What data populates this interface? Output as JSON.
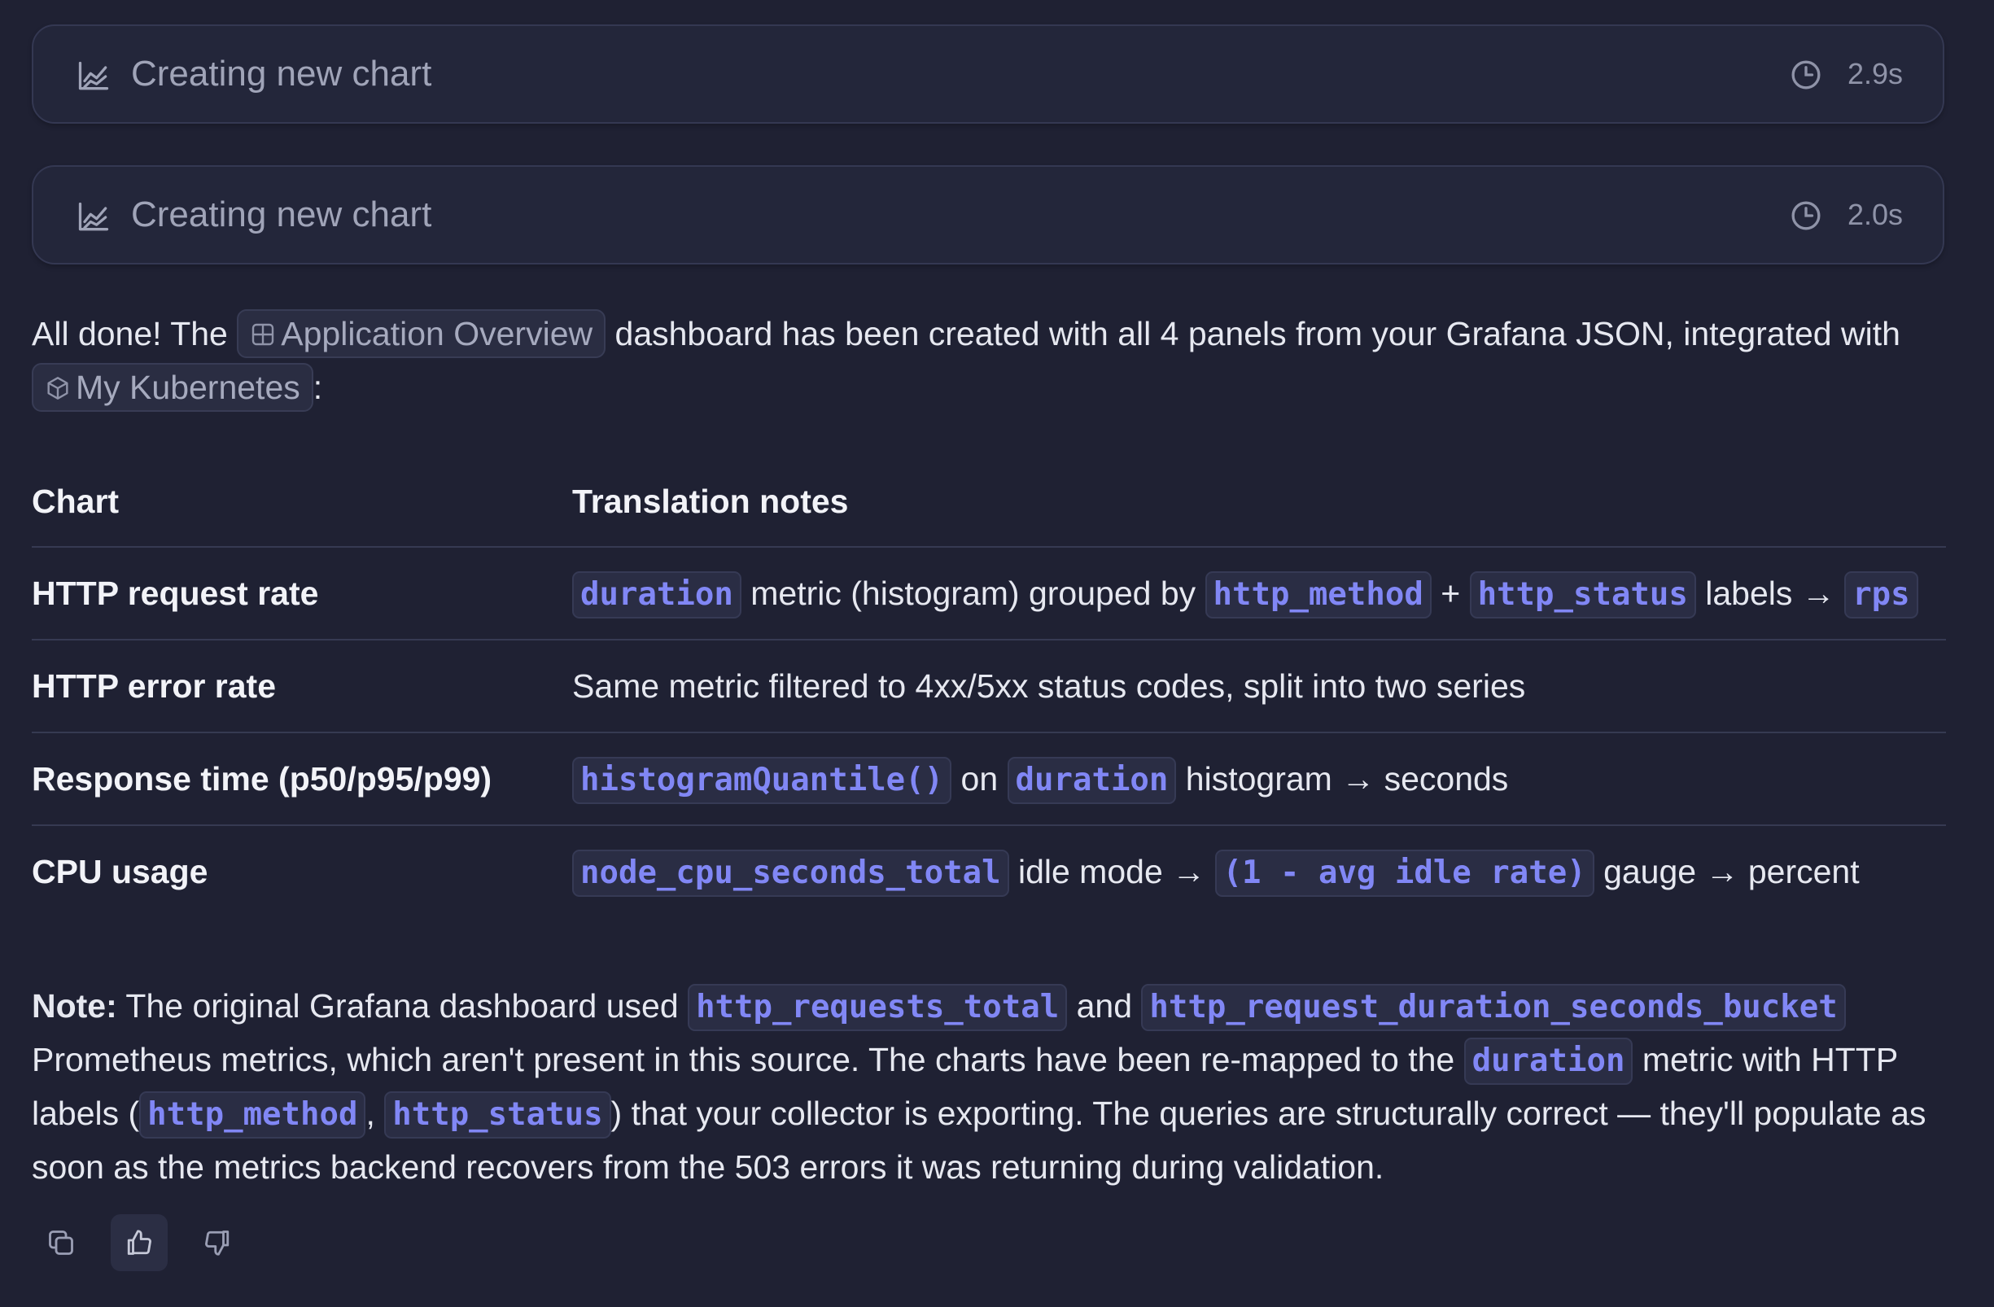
{
  "steps": [
    {
      "title": "Creating new chart",
      "time": "2.9s",
      "icon": "chart-icon"
    },
    {
      "title": "Creating new chart",
      "time": "2.0s",
      "icon": "chart-icon"
    }
  ],
  "summary": {
    "text1": "All done! The",
    "dashboard_chip": "Application Overview",
    "text2": "dashboard has been created with all 4 panels from your Grafana JSON, integrated with",
    "source_chip": "My Kubernetes",
    "text3": ":"
  },
  "table": {
    "headers": [
      "Chart",
      "Translation notes"
    ],
    "rows": [
      {
        "chart": "HTTP request rate",
        "notes": {
          "c1": "duration",
          "t1": "metric (histogram) grouped by",
          "c2": "http_method",
          "t2": "+",
          "c3": "http_status",
          "t3": "labels →",
          "c4": "rps"
        }
      },
      {
        "chart": "HTTP error rate",
        "notes": {
          "t1": "Same metric filtered to 4xx/5xx status codes, split into two series"
        }
      },
      {
        "chart": "Response time (p50/p95/p99)",
        "notes": {
          "c1": "histogramQuantile()",
          "t1": "on",
          "c2": "duration",
          "t2": "histogram → seconds"
        }
      },
      {
        "chart": "CPU usage",
        "notes": {
          "c1": "node_cpu_seconds_total",
          "t1": "idle mode →",
          "c2": "(1 - avg idle rate)",
          "t2": "gauge → percent"
        }
      }
    ]
  },
  "note": {
    "label": "Note:",
    "t1": "The original Grafana dashboard used",
    "c1": "http_requests_total",
    "t2": "and",
    "c2": "http_request_duration_seconds_bucket",
    "t3": "Prometheus metrics, which aren't present in this source. The charts have been re-mapped to the",
    "c3": "duration",
    "t4": "metric with HTTP labels (",
    "c4": "http_method",
    "t5": ",",
    "c5": "http_status",
    "t6": ") that your collector is exporting. The queries are structurally correct — they'll populate as soon as the metrics backend recovers from the 503 errors it was returning during validation."
  },
  "feedback": {
    "copy_icon": "copy-icon",
    "like_icon": "thumbs-up-icon",
    "dislike_icon": "thumbs-down-icon",
    "like_active": true
  },
  "colors": {
    "background": "#1f2133",
    "code": "#8187f5",
    "muted": "#a0a4b8"
  }
}
